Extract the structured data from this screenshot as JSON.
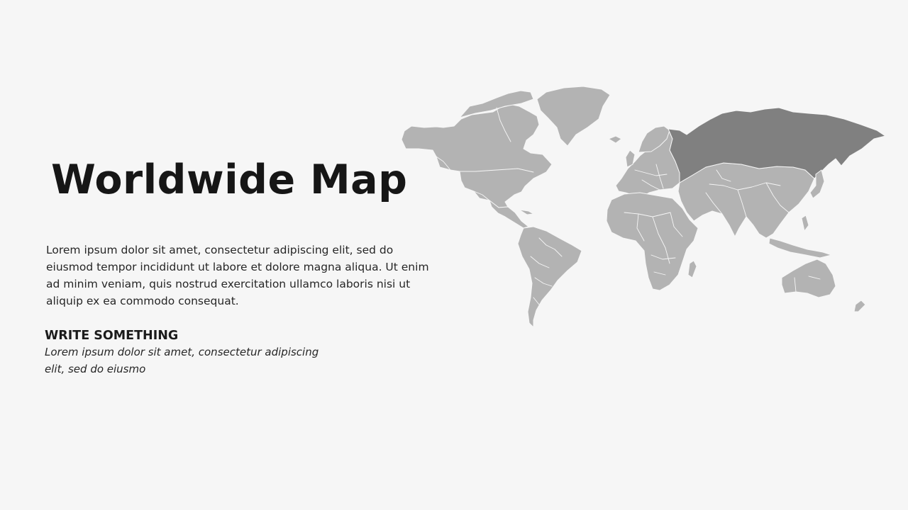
{
  "slide": {
    "title": "Worldwide Map",
    "body": "Lorem ipsum dolor sit amet, consectetur adipiscing elit, sed do eiusmod tempor incididunt ut labore et dolore magna aliqua. Ut enim ad minim veniam, quis nostrud exercitation ullamco laboris nisi ut aliquip ex ea commodo consequat.",
    "subheading": "WRITE SOMETHING",
    "subtext": "Lorem ipsum dolor sit amet, consectetur adipiscing elit, sed do eiusmo"
  },
  "map": {
    "highlighted_region": "russia",
    "colors": {
      "background": "#f6f6f6",
      "land": "#b3b3b3",
      "highlight": "#808080",
      "borders": "#f6f6f6"
    }
  }
}
